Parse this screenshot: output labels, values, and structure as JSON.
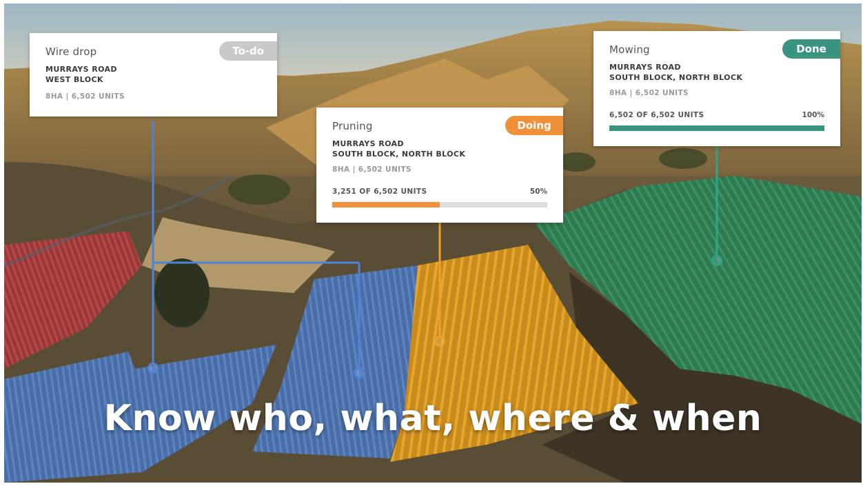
{
  "cards": {
    "wire": {
      "title": "Wire drop",
      "status": "To-do",
      "location_line1": "MURRAYS ROAD",
      "location_line2": "WEST BLOCK",
      "meta": "8HA | 6,502 UNITS",
      "status_color": "#c9c9c9",
      "line_color": "#4f82d9"
    },
    "pruning": {
      "title": "Pruning",
      "status": "Doing",
      "location_line1": "MURRAYS ROAD",
      "location_line2": "SOUTH BLOCK, NORTH BLOCK",
      "meta": "8HA | 6,502 UNITS",
      "progress_text": "3,251 OF 6,502 UNITS",
      "percent_text": "50%",
      "progress": 0.5,
      "status_color": "#f0913a",
      "line_color": "#f0a030"
    },
    "mowing": {
      "title": "Mowing",
      "status": "Done",
      "location_line1": "MURRAYS ROAD",
      "location_line2": "SOUTH BLOCK, NORTH BLOCK",
      "meta": "8HA | 6,502 UNITS",
      "progress_text": "6,502 OF 6,502 UNITS",
      "percent_text": "100%",
      "progress": 1.0,
      "status_color": "#3a9480",
      "line_color": "#2fa48c"
    }
  },
  "headline": "Know who, what, where & when"
}
